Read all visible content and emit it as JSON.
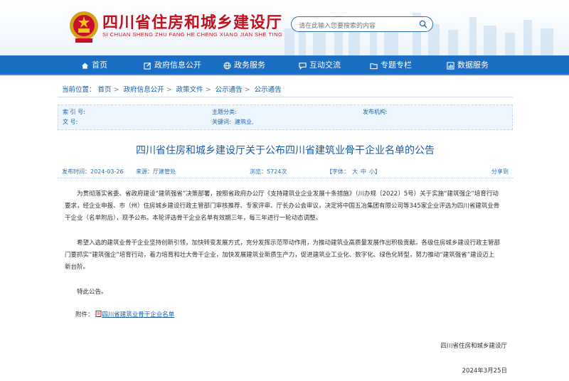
{
  "header": {
    "title": "四川省住房和城乡建设厅",
    "subtitle": "SI CHUAN SHENG ZHU FANG HE CHENG XIANG JIAN SHE TING",
    "search_placeholder": "请在此输入您要搜索的内容",
    "brand_color": "#c1121f"
  },
  "nav": {
    "bg_color": "#1a6fc4",
    "items": [
      {
        "label": "首页",
        "icon": "home-icon"
      },
      {
        "label": "政府信息公开",
        "icon": "edit-icon"
      },
      {
        "label": "政务服务",
        "icon": "globe-icon"
      },
      {
        "label": "互动交流",
        "icon": "chat-icon"
      },
      {
        "label": "专题专栏",
        "icon": "folder-icon"
      },
      {
        "label": "数据服务",
        "icon": "chart-icon"
      }
    ]
  },
  "breadcrumb": {
    "prefix": "当前位置：",
    "items": [
      "首页",
      "政府信息公开",
      "政策文件",
      "公示通告",
      "公示通告"
    ],
    "sep": ">"
  },
  "info": {
    "index_label": "索 引 号:",
    "issuer_label": "发布机构:",
    "topic_label": "主题分类:",
    "docno_label": "文     号:",
    "keywords_label": "关键词:",
    "keywords_value": "建筑业,"
  },
  "article": {
    "title": "四川省住房和城乡建设厅关于公布四川省建筑业骨干企业名单的公告",
    "date_label": "发布时间：",
    "date_value": "2024-03-26",
    "source_label": "来源：",
    "source_value": "厅建管处",
    "views_label": "浏览：",
    "views_value": "5724次",
    "font_label": "【字体：",
    "font_sizes": [
      "大",
      "中",
      "小"
    ],
    "font_close": "】",
    "share_label": "分享到",
    "paragraphs": [
      "为贯彻落实省委、省政府建设“建筑强省”决策部署，按照省政府办公厅《支持建筑业企业发展十条措施》（川办规〔2022〕5号）关于实施“建筑强企”培育行动要求，经企业申报、市（州）住房城乡建设行政主管部门审核推荐、专家评审、厅长办公会审议，决定将中国五冶集团有限公司等345家企业评选为四川省建筑业骨干企业（名单附后），现予公布。本轮评选骨干企业名单有效期三年，每三年进行一轮动态调整。",
      "希望入选的建筑业骨干企业坚持创新引领，加快转变发展方式，充分发挥示范带动作用，为推动建筑业高质量发展作出积极贡献。各级住房城乡建设行政主管部门要抓实“建筑强企”培育行动，着力培育和壮大骨干企业，加快发展建筑业新质生产力，促进建筑业工业化、数字化、绿色化转型，努力推动“建筑强省”建设迈上新台阶。",
      "特此公告。"
    ],
    "attach_label": "附件：",
    "attach_link": "四川省建筑业骨干企业名单",
    "sign_org": "四川省住房和城乡建设厅",
    "sign_date": "2024年3月25日"
  }
}
